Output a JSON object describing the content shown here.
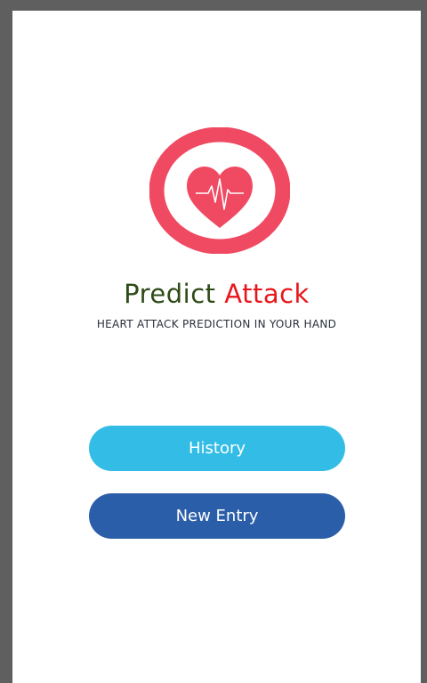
{
  "app": {
    "brand_word1": "Predict",
    "brand_word2": "Attack",
    "tagline": "HEART ATTACK PREDICTION IN YOUR HAND"
  },
  "buttons": {
    "history_label": "History",
    "new_entry_label": "New Entry"
  },
  "icons": {
    "logo": "heart-pulse-icon"
  },
  "colors": {
    "logo_red": "#f04a63",
    "brand_green": "#2e4b18",
    "brand_red": "#e8161a",
    "history_button": "#33bde6",
    "new_entry_button": "#2b5ea8"
  }
}
